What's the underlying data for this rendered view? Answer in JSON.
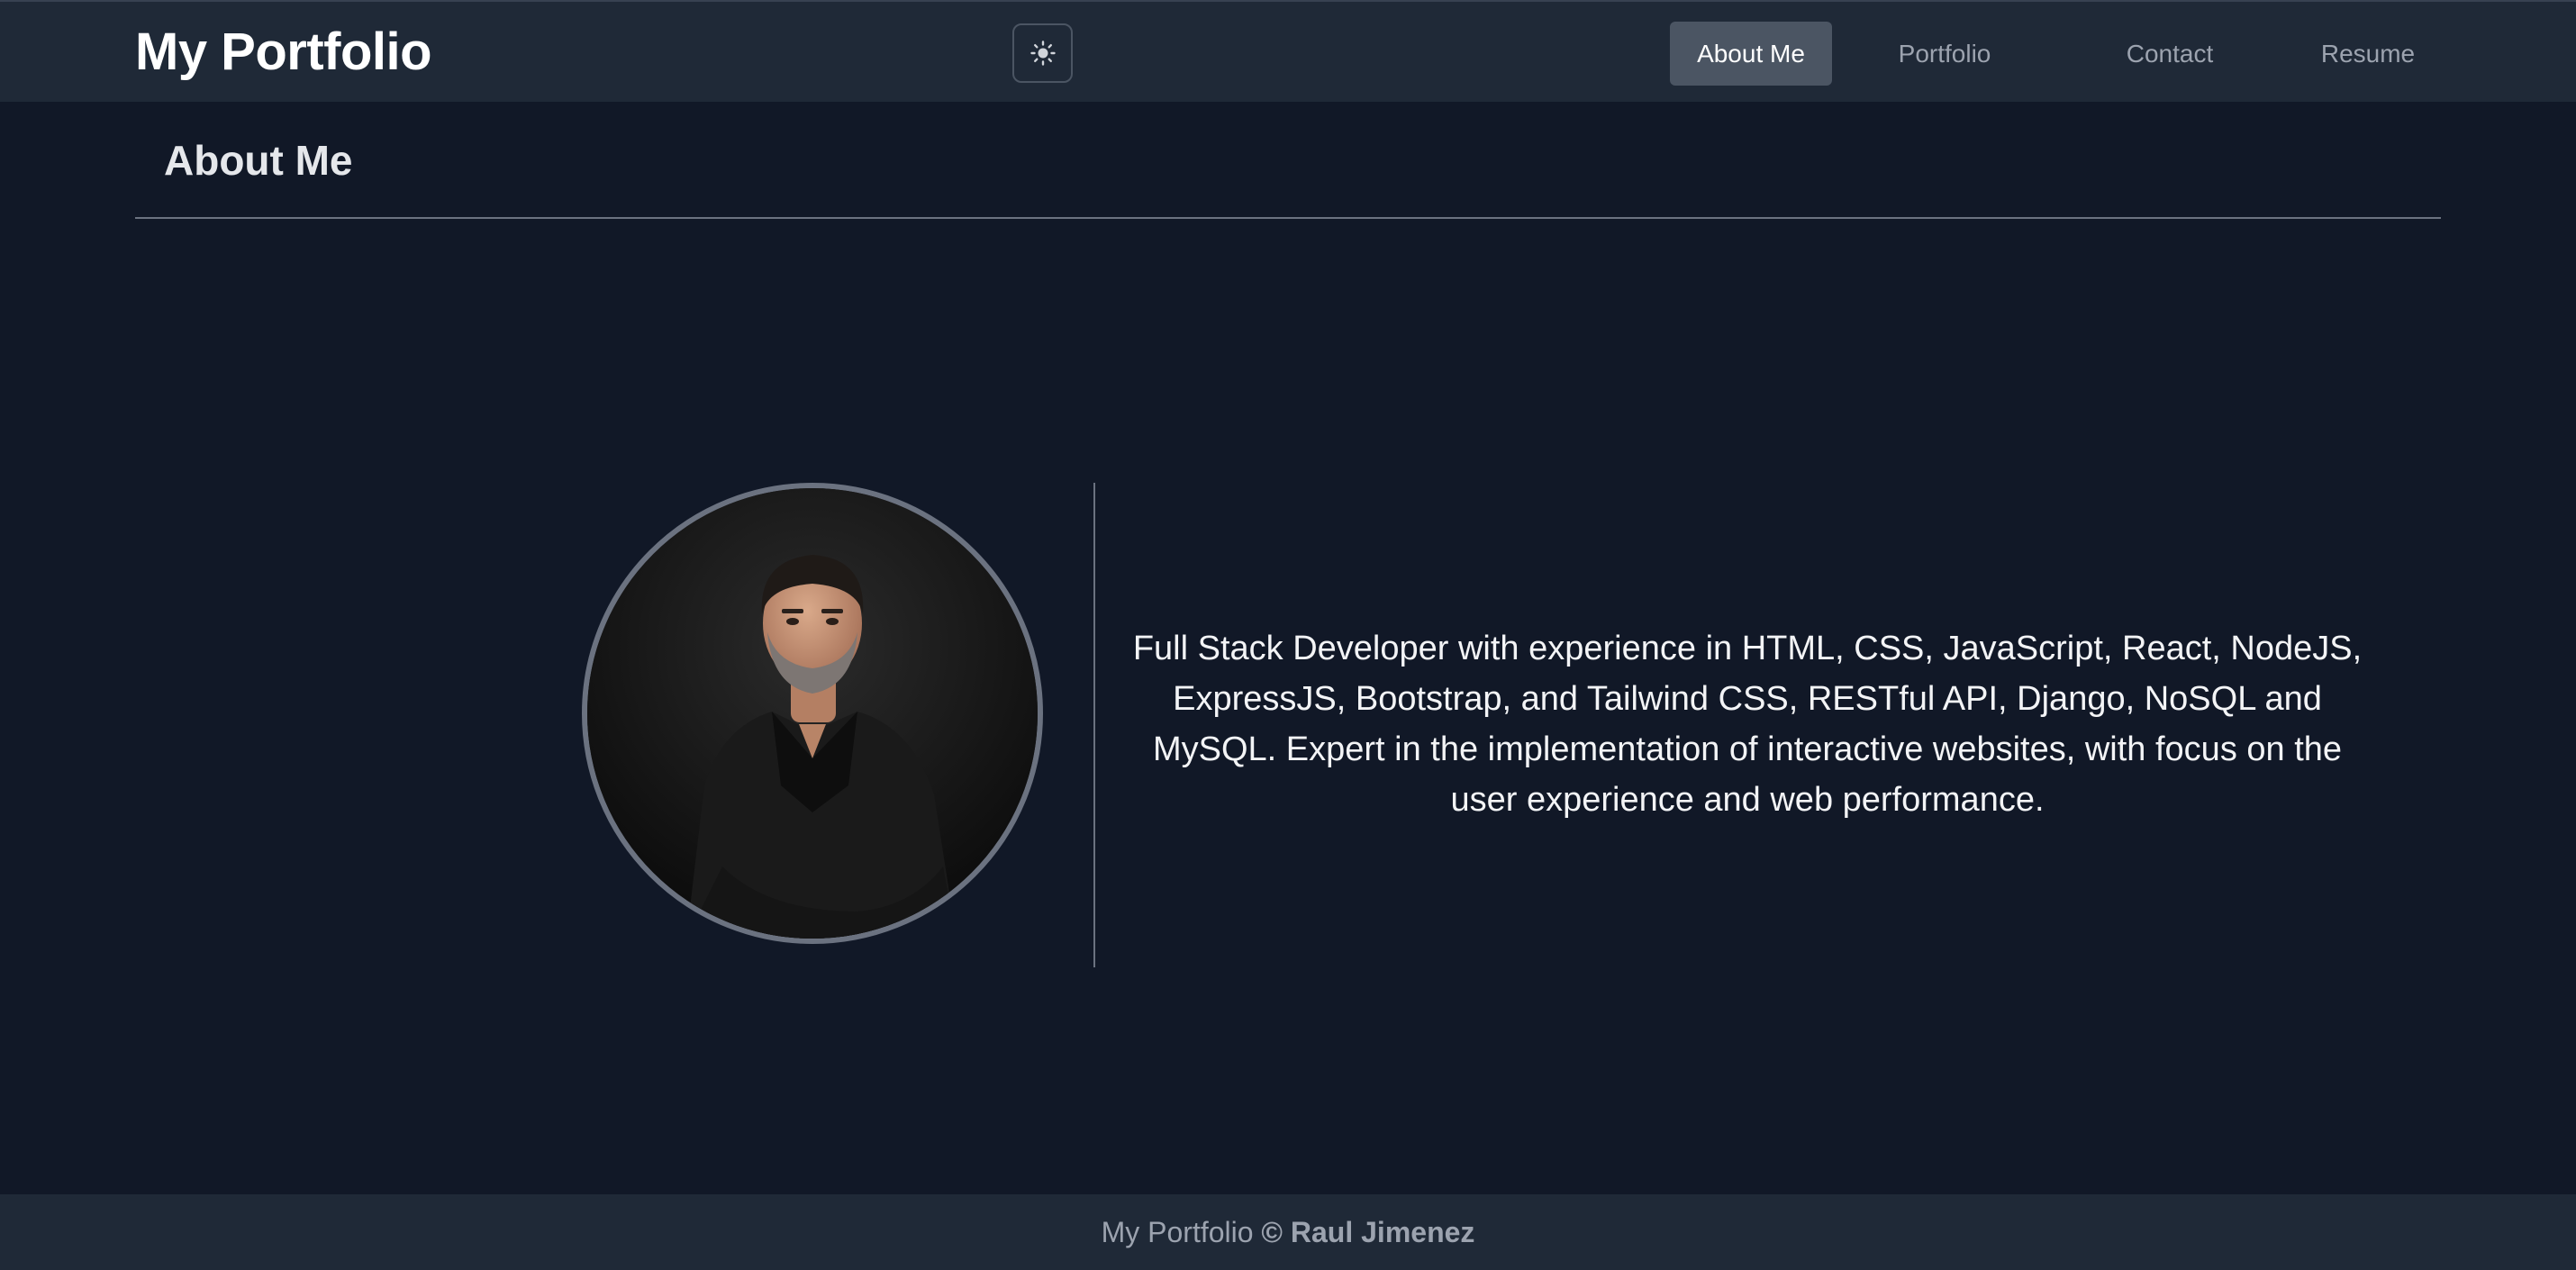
{
  "header": {
    "brand": "My Portfolio",
    "theme_toggle_icon": "sun-icon",
    "nav": [
      {
        "label": "About Me",
        "active": true
      },
      {
        "label": "Portfolio",
        "active": false
      },
      {
        "label": "Contact",
        "active": false
      },
      {
        "label": "Resume",
        "active": false
      }
    ]
  },
  "about": {
    "title": "About Me",
    "bio": "Full Stack Developer with experience in HTML, CSS, JavaScript, React, NodeJS, ExpressJS, Bootstrap, and Tailwind CSS, RESTful API, Django, NoSQL and MySQL. Expert in the implementation of interactive websites, with focus on the user experience and web performance."
  },
  "footer": {
    "prefix": "My Portfolio",
    "copyright": "©",
    "author": "Raul Jimenez"
  },
  "colors": {
    "page_bg": "#111827",
    "header_bg": "#1f2937",
    "active_nav_bg": "#4b5563",
    "divider": "#6b7280"
  }
}
